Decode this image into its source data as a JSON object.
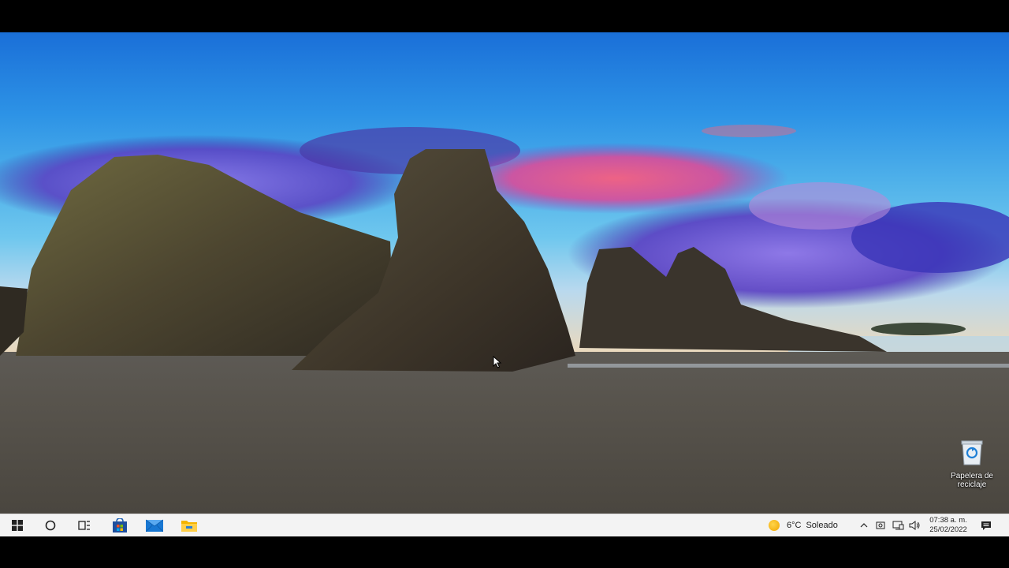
{
  "desktop": {
    "recycle_bin_label": "Papelera de reciclaje"
  },
  "taskbar": {
    "start_icon": "windows-logo-icon",
    "search_icon": "cortana-circle-icon",
    "taskview_icon": "task-view-icon",
    "pinned_apps": [
      {
        "name": "store-icon"
      },
      {
        "name": "mail-icon"
      },
      {
        "name": "file-explorer-icon"
      }
    ],
    "weather": {
      "icon": "sun-icon",
      "temperature": "6°C",
      "condition": "Soleado"
    },
    "tray_icons": [
      "chevron-up-icon",
      "meet-now-icon",
      "network-icon",
      "volume-icon"
    ],
    "clock": {
      "time": "07:38 a. m.",
      "date": "25/02/2022"
    },
    "notification_icon": "action-center-icon"
  }
}
